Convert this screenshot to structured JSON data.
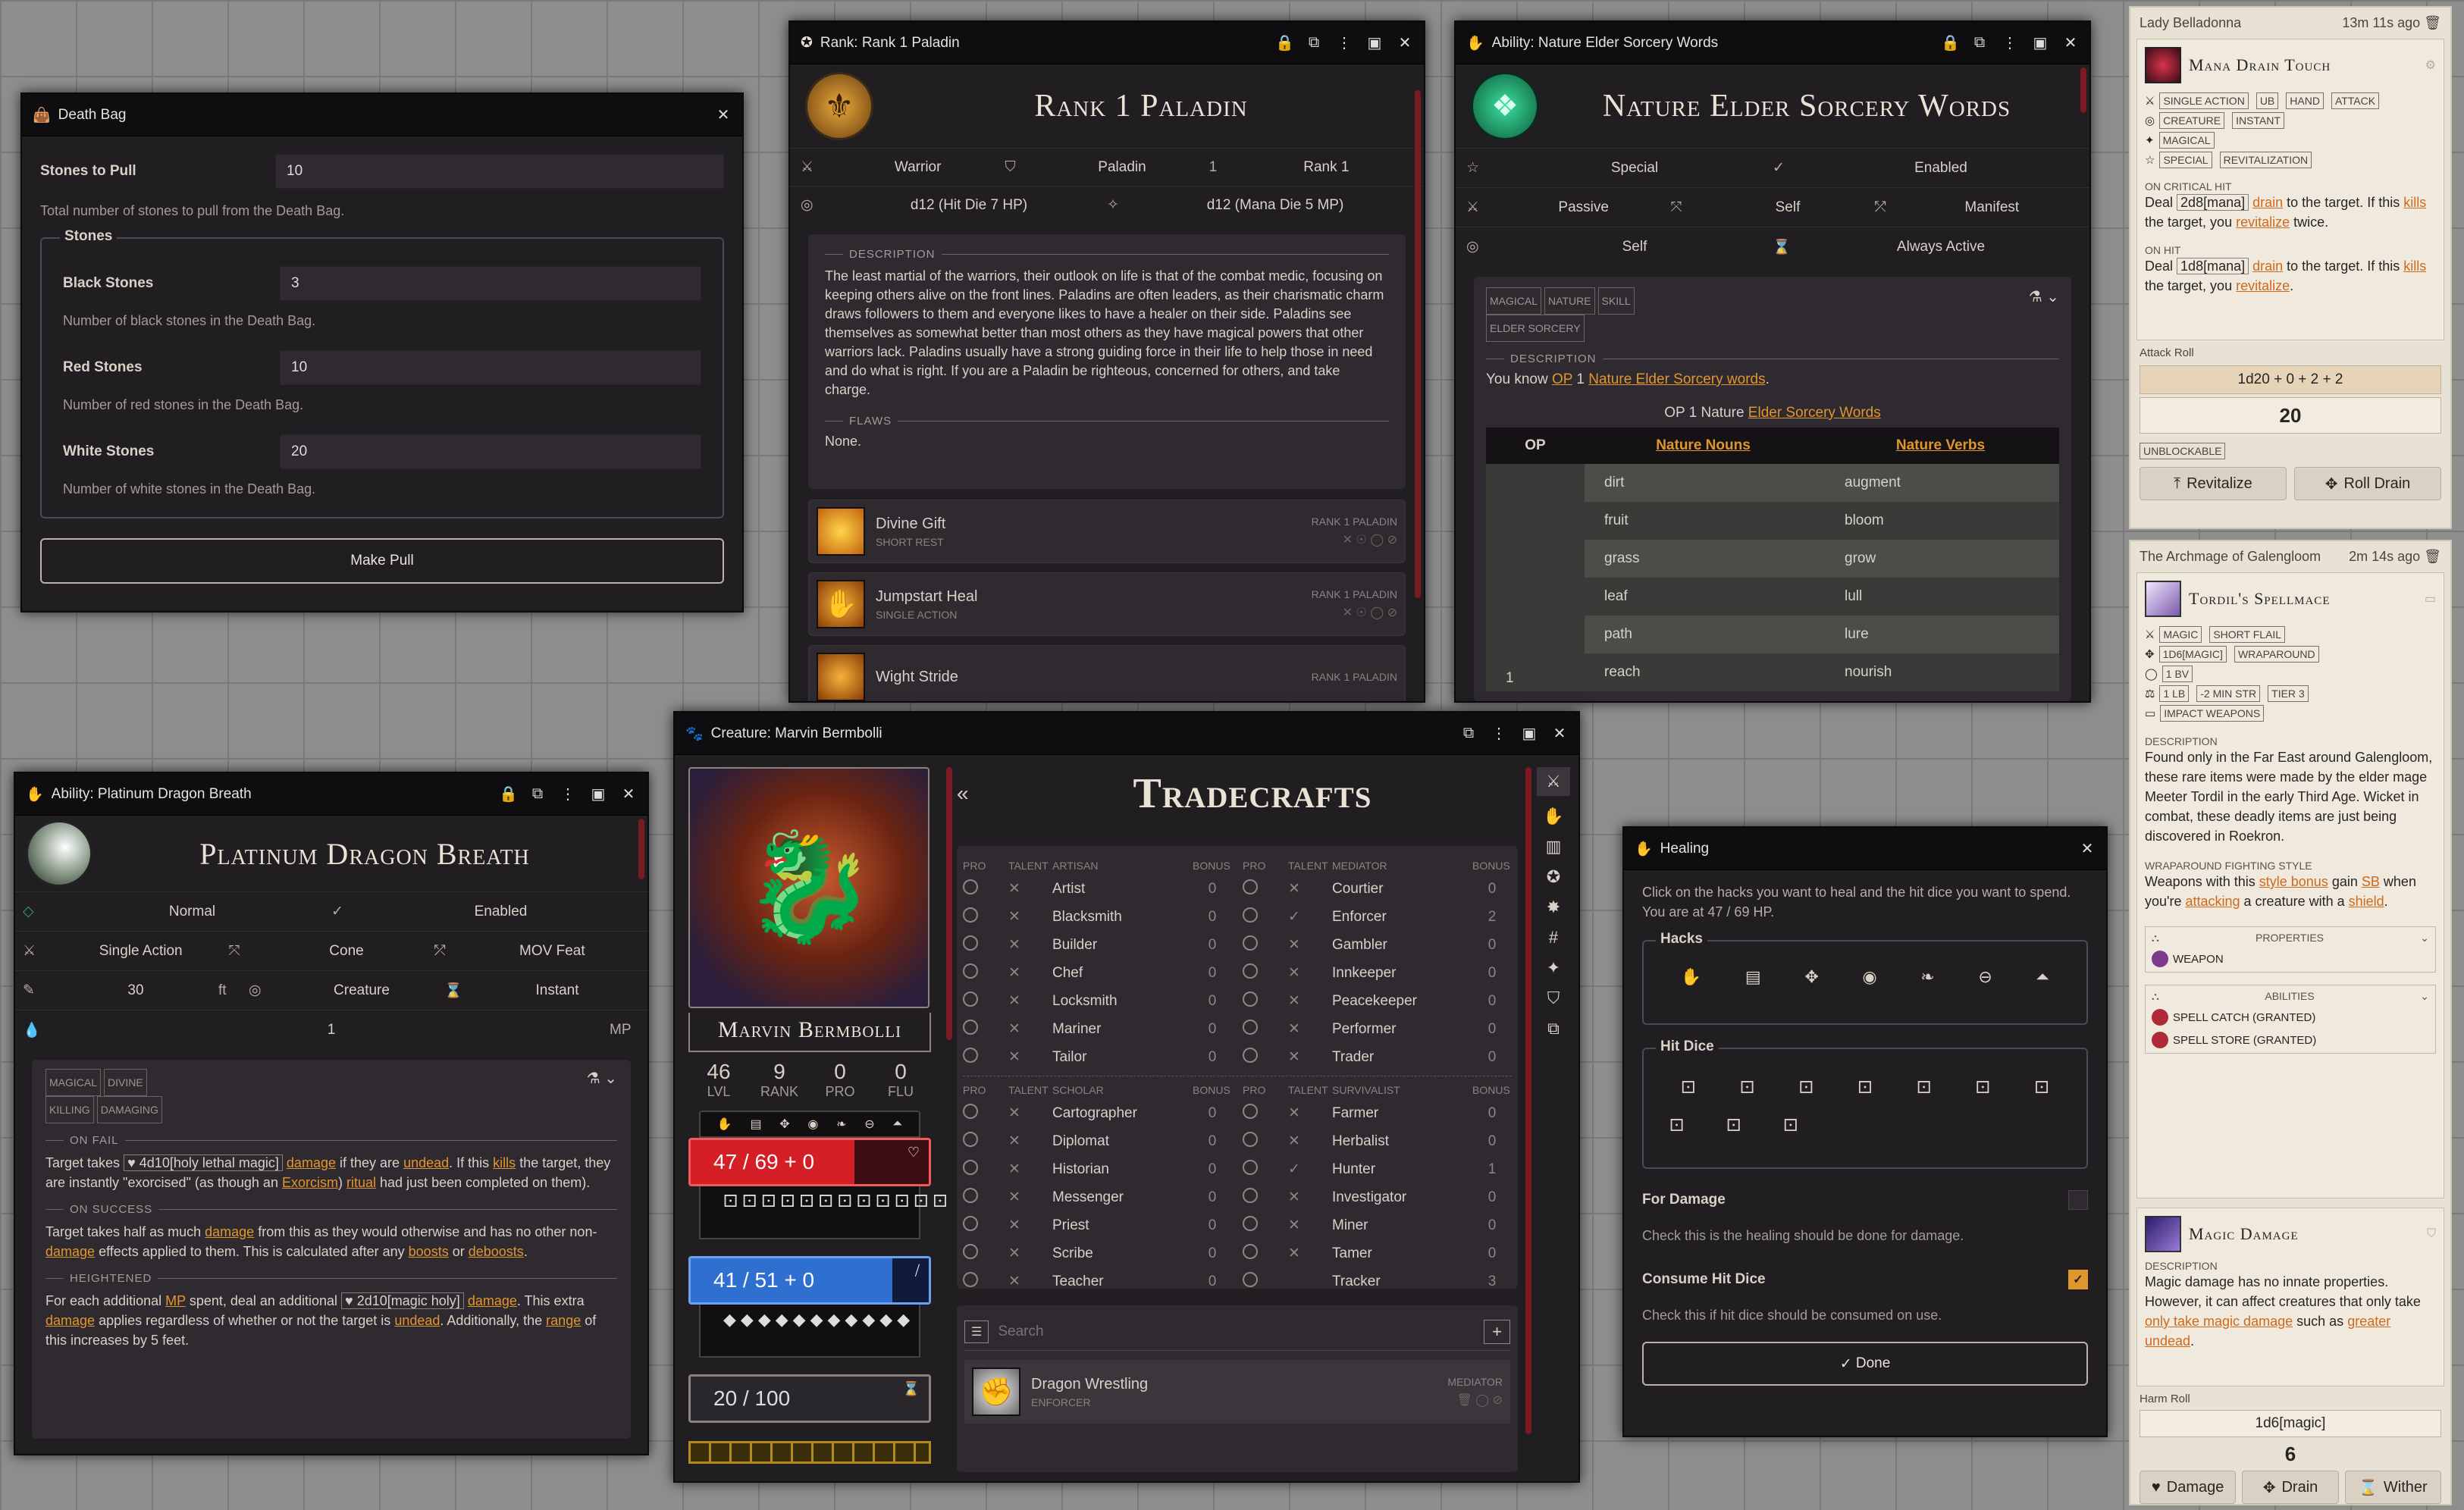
{
  "death_bag": {
    "title": "Death Bag",
    "stones_label": "Stones to Pull",
    "stones_value": "10",
    "stones_hint": "Total number of stones to pull from the Death Bag.",
    "legend": "Stones",
    "rows": [
      {
        "label": "Black Stones",
        "value": "3",
        "hint": "Number of black stones in the Death Bag."
      },
      {
        "label": "Red Stones",
        "value": "10",
        "hint": "Number of red stones in the Death Bag."
      },
      {
        "label": "White Stones",
        "value": "20",
        "hint": "Number of white stones in the Death Bag."
      }
    ],
    "button": "Make Pull"
  },
  "rank": {
    "header": "Rank: Rank 1 Paladin",
    "title": "Rank 1 Paladin",
    "r1": [
      "Warrior",
      "Paladin",
      "Rank 1"
    ],
    "r2": [
      "d12 (Hit Die 7 HP)",
      "d12 (Mana Die 5 MP)"
    ],
    "desc_label": "DESCRIPTION",
    "desc": "The least martial of the warriors, their outlook on life is that of the combat medic, focusing on keeping others alive on the front lines. Paladins are often leaders, as their charismatic charm draws followers to them and everyone likes to have a healer on their side. Paladins see themselves as somewhat better than most others as they have magical powers that other warriors lack. Paladins usually have a strong guiding force in their life to help those in need and do what is right. If you are a Paladin be righteous, concerned for others, and take charge.",
    "flaws_label": "FLAWS",
    "flaws": "None.",
    "items": [
      {
        "name": "Divine Gift",
        "sub": "SHORT REST",
        "tag": "RANK 1 PALADIN"
      },
      {
        "name": "Jumpstart Heal",
        "sub": "SINGLE ACTION",
        "tag": "RANK 1 PALADIN"
      },
      {
        "name": "Wight Stride",
        "sub": "",
        "tag": "RANK 1 PALADIN"
      }
    ]
  },
  "nature": {
    "header": "Ability: Nature Elder Sorcery Words",
    "title": "Nature Elder Sorcery Words",
    "r1": [
      "Special",
      "Enabled"
    ],
    "r2": [
      "Passive",
      "Self",
      "Manifest"
    ],
    "r3": [
      "Self",
      "Always Active"
    ],
    "tags": [
      "MAGICAL",
      "NATURE",
      "SKILL",
      "ELDER SORCERY"
    ],
    "desc_label": "DESCRIPTION",
    "desc_pre": "You know",
    "desc_op": "OP",
    "desc_mid": "1",
    "desc_link": "Nature Elder Sorcery words",
    "desc_end": ".",
    "caption_pre": "OP 1 Nature",
    "caption_link": "Elder Sorcery Words",
    "th": [
      "OP",
      "Nature Nouns",
      "Nature Verbs"
    ],
    "op_val": "1",
    "rows": [
      [
        "dirt",
        "augment"
      ],
      [
        "fruit",
        "bloom"
      ],
      [
        "grass",
        "grow"
      ],
      [
        "leaf",
        "lull"
      ],
      [
        "path",
        "lure"
      ],
      [
        "reach",
        "nourish"
      ]
    ]
  },
  "lady": {
    "name": "Lady Belladonna",
    "time": "13m 11s ago",
    "ability": "Mana Drain Touch",
    "tags1": [
      "SINGLE ACTION",
      "UB",
      "HAND",
      "ATTACK"
    ],
    "tags2": [
      "CREATURE",
      "INSTANT"
    ],
    "tags3": [
      "MAGICAL"
    ],
    "tags4": [
      "SPECIAL",
      "REVITALIZATION"
    ],
    "crit_label": "ON CRITICAL HIT",
    "crit_a": "Deal",
    "crit_dice": "2d8[mana]",
    "crit_link": "drain",
    "crit_b": "to the target. If this",
    "crit_kills": "kills",
    "crit_c": "the target, you",
    "crit_revit": "revitalize",
    "crit_d": "twice.",
    "hit_label": "ON HIT",
    "hit_a": "Deal",
    "hit_dice": "1d8[mana]",
    "hit_link": "drain",
    "hit_b": "to the target. If this",
    "hit_kills": "kills",
    "hit_c": "the target, you",
    "hit_revit": "revitalize",
    "hit_d": ".",
    "attack_label": "Attack Roll",
    "formula": "1d20 + 0 + 2 + 2",
    "result": "20",
    "tag_unblock": "UNBLOCKABLE",
    "b1": "Revitalize",
    "b2": "Roll Drain"
  },
  "arch": {
    "name": "The Archmage of Galengloom",
    "time": "2m 14s ago",
    "item": "Tordil's Spellmace",
    "tags1": [
      "MAGIC",
      "SHORT FLAIL"
    ],
    "tags2": [
      "1D6[MAGIC]",
      "WRAPAROUND"
    ],
    "tags3": [
      "1 BV"
    ],
    "tags4": [
      "1 LB",
      "-2 MIN STR",
      "TIER 3"
    ],
    "tags5": [
      "IMPACT WEAPONS"
    ],
    "desc_label": "DESCRIPTION",
    "desc": "Found only in the Far East around Galengloom, these rare items were made by the elder mage Meeter Tordil in the early Third Age. Wicket in combat, these deadly items are just being discovered in Roekron.",
    "wrap_label": "WRAPAROUND FIGHTING STYLE",
    "wrap_a": "Weapons with this",
    "wrap_link1": "style bonus",
    "wrap_b": "gain",
    "wrap_sb": "SB",
    "wrap_c": "when you're",
    "wrap_link2": "attacking",
    "wrap_d": "a creature with a",
    "wrap_link3": "shield",
    "wrap_e": ".",
    "props_label": "PROPERTIES",
    "prop": "WEAPON",
    "abil_label": "ABILITIES",
    "abil1": "SPELL CATCH (GRANTED)",
    "abil2": "SPELL STORE (GRANTED)",
    "magic": "Magic Damage",
    "m_desc_label": "DESCRIPTION",
    "m_desc_a": "Magic damage has no innate properties. However, it can affect creatures that only take",
    "m_link1": "only take magic damage",
    "m_desc_b": "such as",
    "m_link2": "greater undead",
    "m_desc_c": ".",
    "harm_label": "Harm Roll",
    "harm": "1d6[magic]",
    "harm_res": "6",
    "c1": "Damage",
    "c2": "Drain",
    "c3": "Wither"
  },
  "plat": {
    "header": "Ability: Platinum Dragon Breath",
    "title": "Platinum Dragon Breath",
    "r1": [
      "Normal",
      "Enabled"
    ],
    "r2": [
      "Single Action",
      "Cone",
      "MOV Feat"
    ],
    "r3": [
      "30",
      "ft",
      "Creature",
      "Instant"
    ],
    "r4": [
      "1",
      "MP"
    ],
    "tags": [
      "MAGICAL",
      "DIVINE",
      "KILLING",
      "DAMAGING"
    ],
    "fail_label": "ON FAIL",
    "fail_a": "Target takes",
    "fail_dice": "4d10[holy lethal magic]",
    "fail_link": "damage",
    "fail_b": "if they are",
    "fail_undead": "undead",
    "fail_c": ". If this",
    "fail_kills": "kills",
    "fail_d": "the target, they are instantly \"exorcised\" (as though an",
    "fail_exorcism": "Exorcism",
    "fail_ritual": "ritual",
    "fail_e": "had just been completed on them).",
    "succ_label": "ON SUCCESS",
    "succ_a": "Target takes half as much",
    "succ_dmg": "damage",
    "succ_b": "from this as they would otherwise and has no other non-",
    "succ_dmg2": "damage",
    "succ_c": "effects applied to them. This is calculated after any",
    "succ_boosts": "boosts",
    "succ_d": "or",
    "succ_deboosts": "deboosts",
    "succ_e": ".",
    "height_label": "HEIGHTENED",
    "height_a": "For each additional",
    "height_mp": "MP",
    "height_b": "spent, deal an additional",
    "height_dice": "2d10[magic holy]",
    "height_dmg": "damage",
    "height_c": ". This extra",
    "height_dmg2": "damage",
    "height_d": "applies regardless of whether or not the target is",
    "height_undead": "undead",
    "height_e": ". Additionally, the",
    "height_range": "range",
    "height_f": "of this increases by 5 feet."
  },
  "creature": {
    "header": "Creature: Marvin Bermbolli",
    "name": "Marvin Bermbolli",
    "stats": [
      {
        "v": "46",
        "l": "LVL"
      },
      {
        "v": "9",
        "l": "RANK"
      },
      {
        "v": "0",
        "l": "PRO"
      },
      {
        "v": "0",
        "l": "FLU"
      }
    ],
    "hp": "47 / 69 + 0",
    "mp": "41 / 51 + 0",
    "fp": "20 / 100",
    "title": "Tradecrafts",
    "cols1": [
      "PRO",
      "TALENT",
      "ARTISAN",
      "BONUS"
    ],
    "cols2": [
      "PRO",
      "TALENT",
      "MEDIATOR",
      "BONUS"
    ],
    "cols3": [
      "PRO",
      "TALENT",
      "SCHOLAR",
      "BONUS"
    ],
    "cols4": [
      "PRO",
      "TALENT",
      "SURVIVALIST",
      "BONUS"
    ],
    "artisan": [
      [
        "Artist",
        "0",
        "x"
      ],
      [
        "Blacksmith",
        "0",
        "x"
      ],
      [
        "Builder",
        "0",
        "x"
      ],
      [
        "Chef",
        "0",
        "x"
      ],
      [
        "Locksmith",
        "0",
        "x"
      ],
      [
        "Mariner",
        "0",
        "x"
      ],
      [
        "Tailor",
        "0",
        "x"
      ]
    ],
    "mediator": [
      [
        "Courtier",
        "0",
        "x"
      ],
      [
        "Enforcer",
        "2",
        "v"
      ],
      [
        "Gambler",
        "0",
        "x"
      ],
      [
        "Innkeeper",
        "0",
        "x"
      ],
      [
        "Peacekeeper",
        "0",
        "x"
      ],
      [
        "Performer",
        "0",
        "x"
      ],
      [
        "Trader",
        "0",
        "x"
      ]
    ],
    "scholar": [
      [
        "Cartographer",
        "0",
        "x"
      ],
      [
        "Diplomat",
        "0",
        "x"
      ],
      [
        "Historian",
        "0",
        "x"
      ],
      [
        "Messenger",
        "0",
        "x"
      ],
      [
        "Priest",
        "0",
        "x"
      ],
      [
        "Scribe",
        "0",
        "x"
      ],
      [
        "Teacher",
        "0",
        "x"
      ]
    ],
    "survivalist": [
      [
        "Farmer",
        "0",
        "x"
      ],
      [
        "Herbalist",
        "0",
        "x"
      ],
      [
        "Hunter",
        "1",
        "v"
      ],
      [
        "Investigator",
        "0",
        "x"
      ],
      [
        "Miner",
        "0",
        "x"
      ],
      [
        "Tamer",
        "0",
        "x"
      ],
      [
        "Tracker",
        "3",
        ""
      ]
    ],
    "search_ph": "Search",
    "feat_name": "Dragon Wrestling",
    "feat_sub": "ENFORCER",
    "feat_tag": "MEDIATOR"
  },
  "healing": {
    "title": "Healing",
    "intro": "Click on the hacks you want to heal and the hit dice you want to spend. You are at 47 / 69 HP.",
    "hacks_label": "Hacks",
    "hitdice_label": "Hit Dice",
    "dmg_label": "For Damage",
    "dmg_hint": "Check this is the healing should be done for damage.",
    "consume_label": "Consume Hit Dice",
    "consume_hint": "Check this if hit dice should be consumed on use.",
    "done": "Done"
  },
  "colors": {
    "accent": "#e0962e",
    "hp": "#c8202a",
    "mp": "#2f6fd0",
    "window": "#211e22"
  }
}
